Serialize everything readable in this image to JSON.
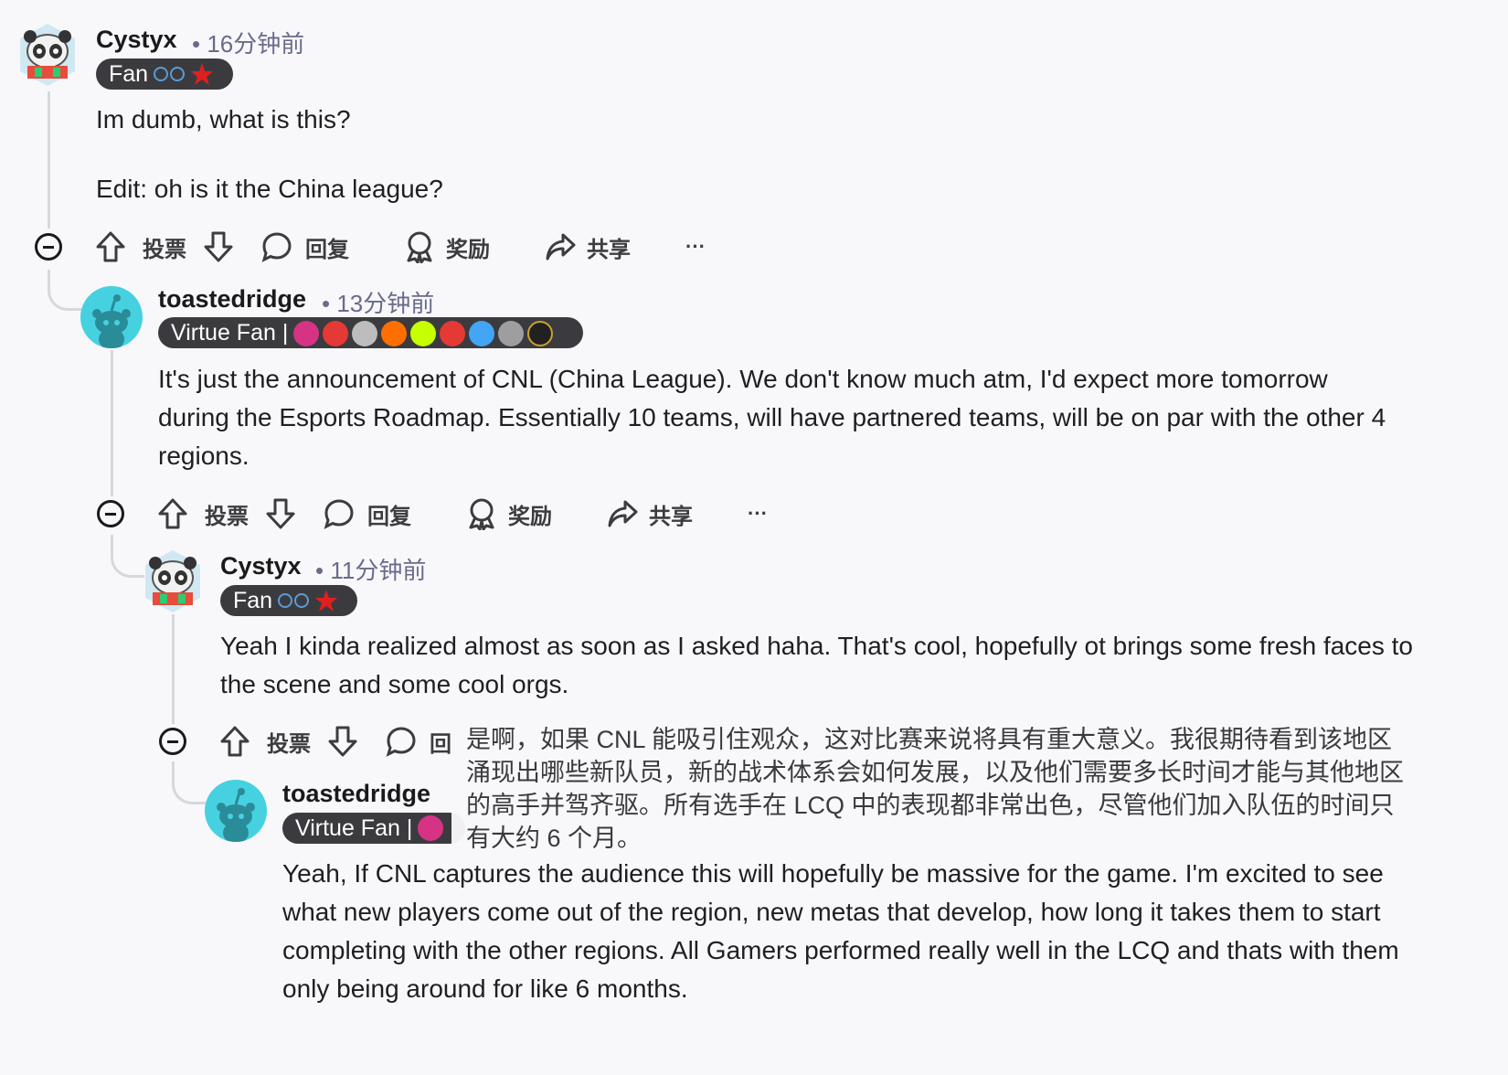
{
  "comments": [
    {
      "username": "Cystyx",
      "time": "• 16分钟前",
      "flair": "Fan",
      "body": [
        "Im dumb, what is this?",
        "Edit: oh is it the China league?"
      ]
    },
    {
      "username": "toastedridge",
      "time": "• 13分钟前",
      "flair": "Virtue Fan |",
      "body": [
        "It's just the announcement of CNL (China League). We don't know much atm, I'd expect more tomorrow during the Esports Roadmap. Essentially 10 teams, will have partnered teams, will be on par with the other 4 regions."
      ]
    },
    {
      "username": "Cystyx",
      "time": "• 11分钟前",
      "flair": "Fan",
      "body": [
        "Yeah I kinda realized almost as soon as I asked haha. That's cool, hopefully ot brings some fresh faces to the scene and some cool orgs."
      ]
    },
    {
      "username": "toastedridge",
      "flair": "Virtue Fan |",
      "body": [
        "Yeah, If CNL captures the audience this will hopefully be massive for the game. I'm excited to see what new players come out of the region, new metas that develop, how long it takes them to start completing with the other regions. All Gamers performed really well in the LCQ and thats with them only being around for like 6 months."
      ]
    }
  ],
  "actions": {
    "vote": "投票",
    "reply": "回复",
    "award": "奖励",
    "share": "共享",
    "more": "···"
  },
  "partial_reply": "回",
  "translation_overlay": "是啊，如果 CNL 能吸引住观众，这对比赛来说将具有重大意义。我很期待看到该地区涌现出哪些新队员，新的战术体系会如何发展，以及他们需要多长时间才能与其他地区的高手并驾齐驱。所有选手在 LCQ 中的表现都非常出色，尽管他们加入队伍的时间只有大约 6 个月。",
  "colors": {
    "avatar_teal": "#46d1e0",
    "flair_bg": "#3b3b3f",
    "thread_line": "#d7d8dc"
  }
}
